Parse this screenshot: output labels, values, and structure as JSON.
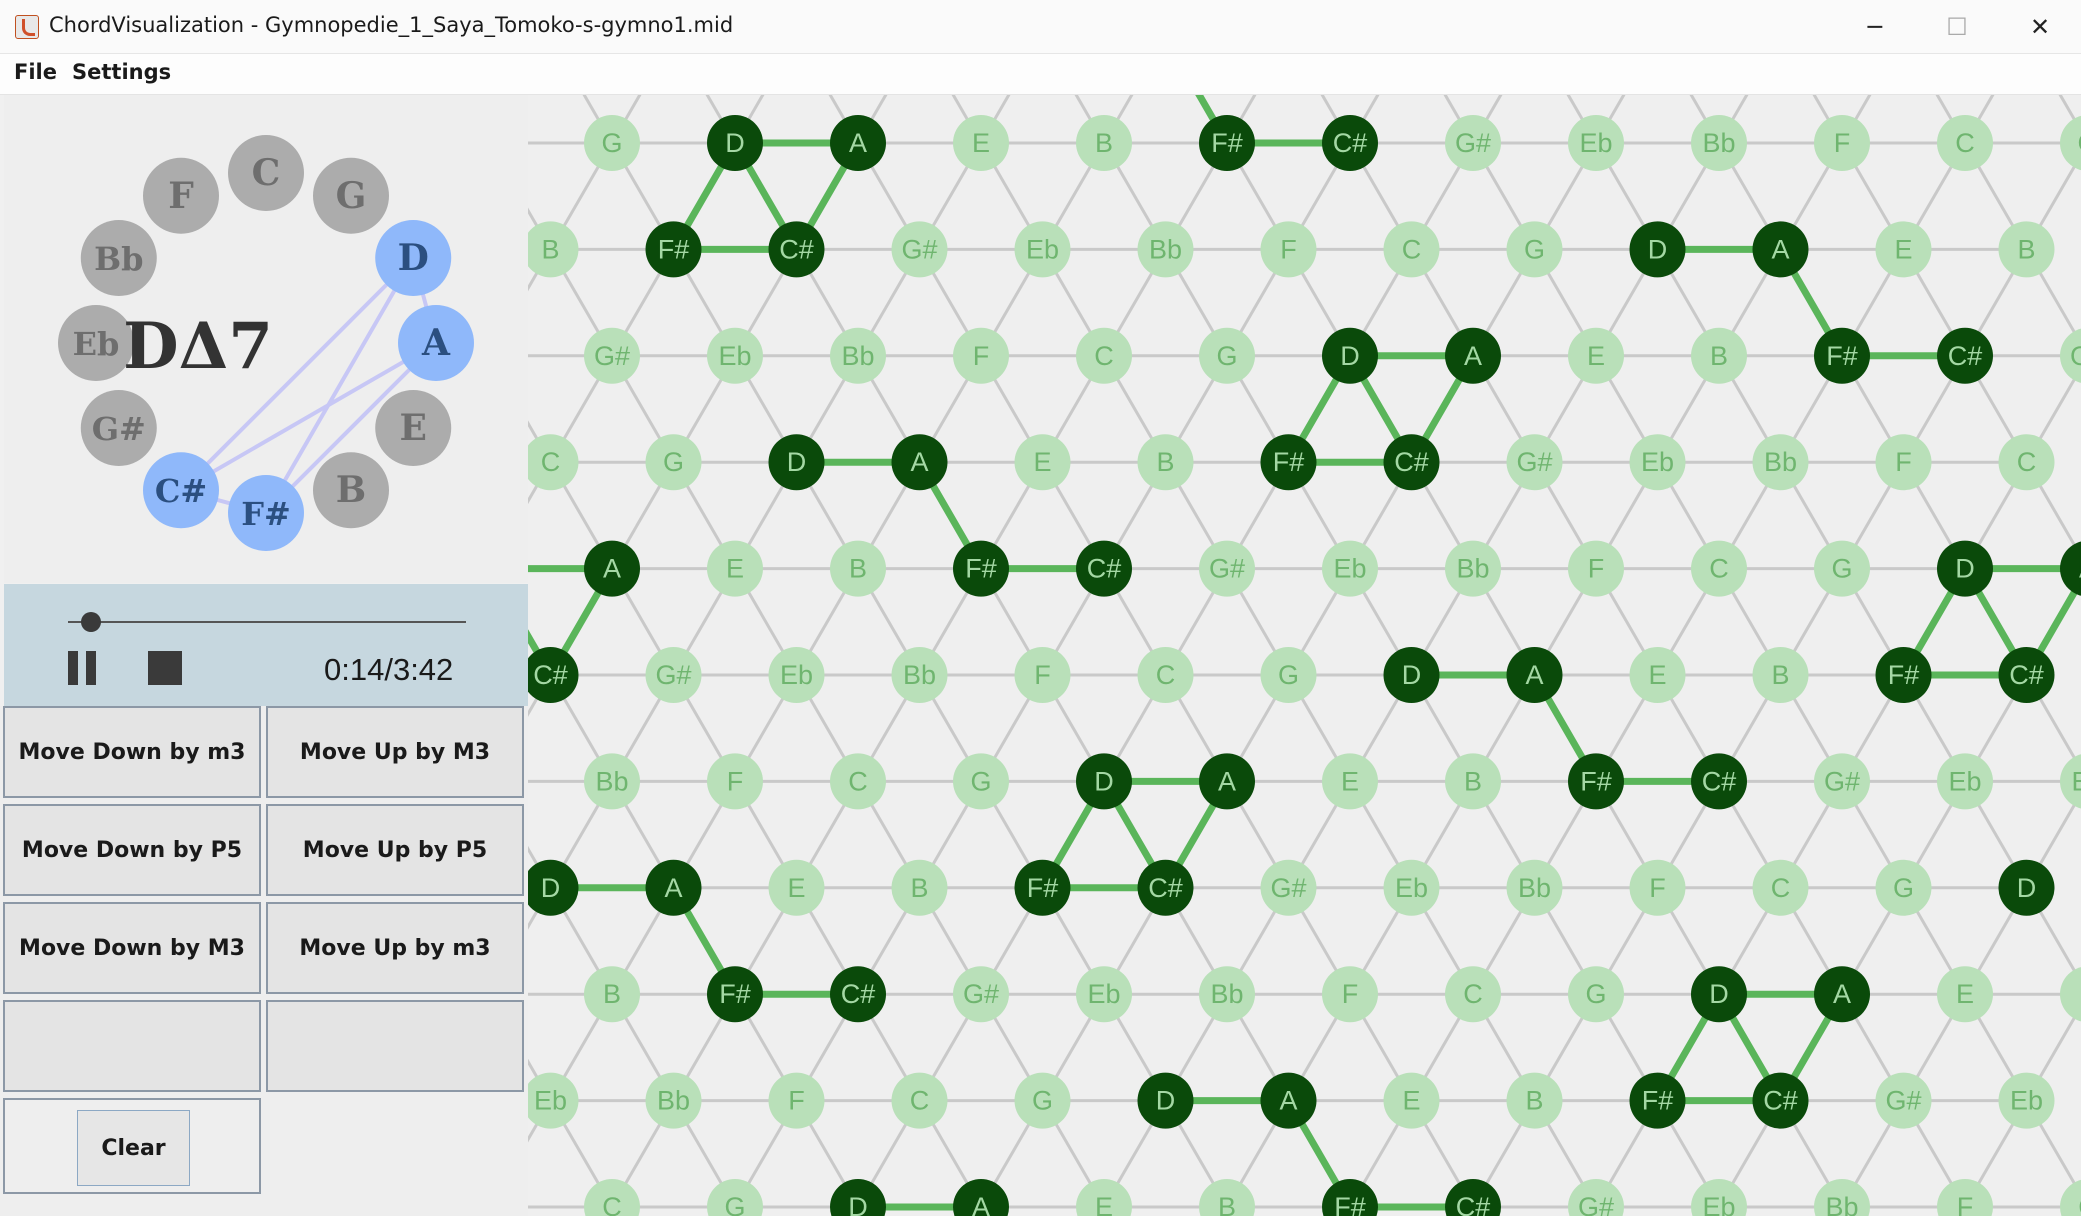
{
  "window": {
    "title": "ChordVisualization - Gymnopedie_1_Saya_Tomoko-s-gymno1.mid",
    "minimize_glyph": "─",
    "maximize_glyph": "☐",
    "close_glyph": "✕"
  },
  "menu": {
    "file": "File",
    "settings": "Settings"
  },
  "circle_of_fifths": {
    "chord_label": "DΔ7",
    "notes": [
      "C",
      "G",
      "D",
      "A",
      "E",
      "B",
      "F#",
      "C#",
      "G#",
      "Eb",
      "Bb",
      "F"
    ],
    "active_notes": [
      "D",
      "A",
      "F#",
      "C#"
    ],
    "colors": {
      "active_fill": "#8fb8fa",
      "inactive_fill": "#acacac",
      "active_text": "#2b4f80",
      "inactive_text": "#6e6e6e",
      "link": "#c7c7f5"
    }
  },
  "player": {
    "time": "0:14/3:42",
    "progress": 0.057
  },
  "controls": {
    "move_down_m3": "Move Down by m3",
    "move_up_M3": "Move Up by M3",
    "move_down_P5": "Move Down by P5",
    "move_up_P5": "Move Up by P5",
    "move_down_M3": "Move Down by M3",
    "move_up_m3": "Move Up by m3",
    "clear": "Clear"
  },
  "tonnetz": {
    "active_notes": [
      "D",
      "A",
      "F#",
      "C#"
    ],
    "colors": {
      "active_fill": "#0a4a0a",
      "active_text": "#a4d8a4",
      "inactive_fill": "#b9e0b9",
      "inactive_text": "#6fb56f",
      "edge": "#c9c9c9",
      "active_edge": "#5ab55a"
    }
  }
}
